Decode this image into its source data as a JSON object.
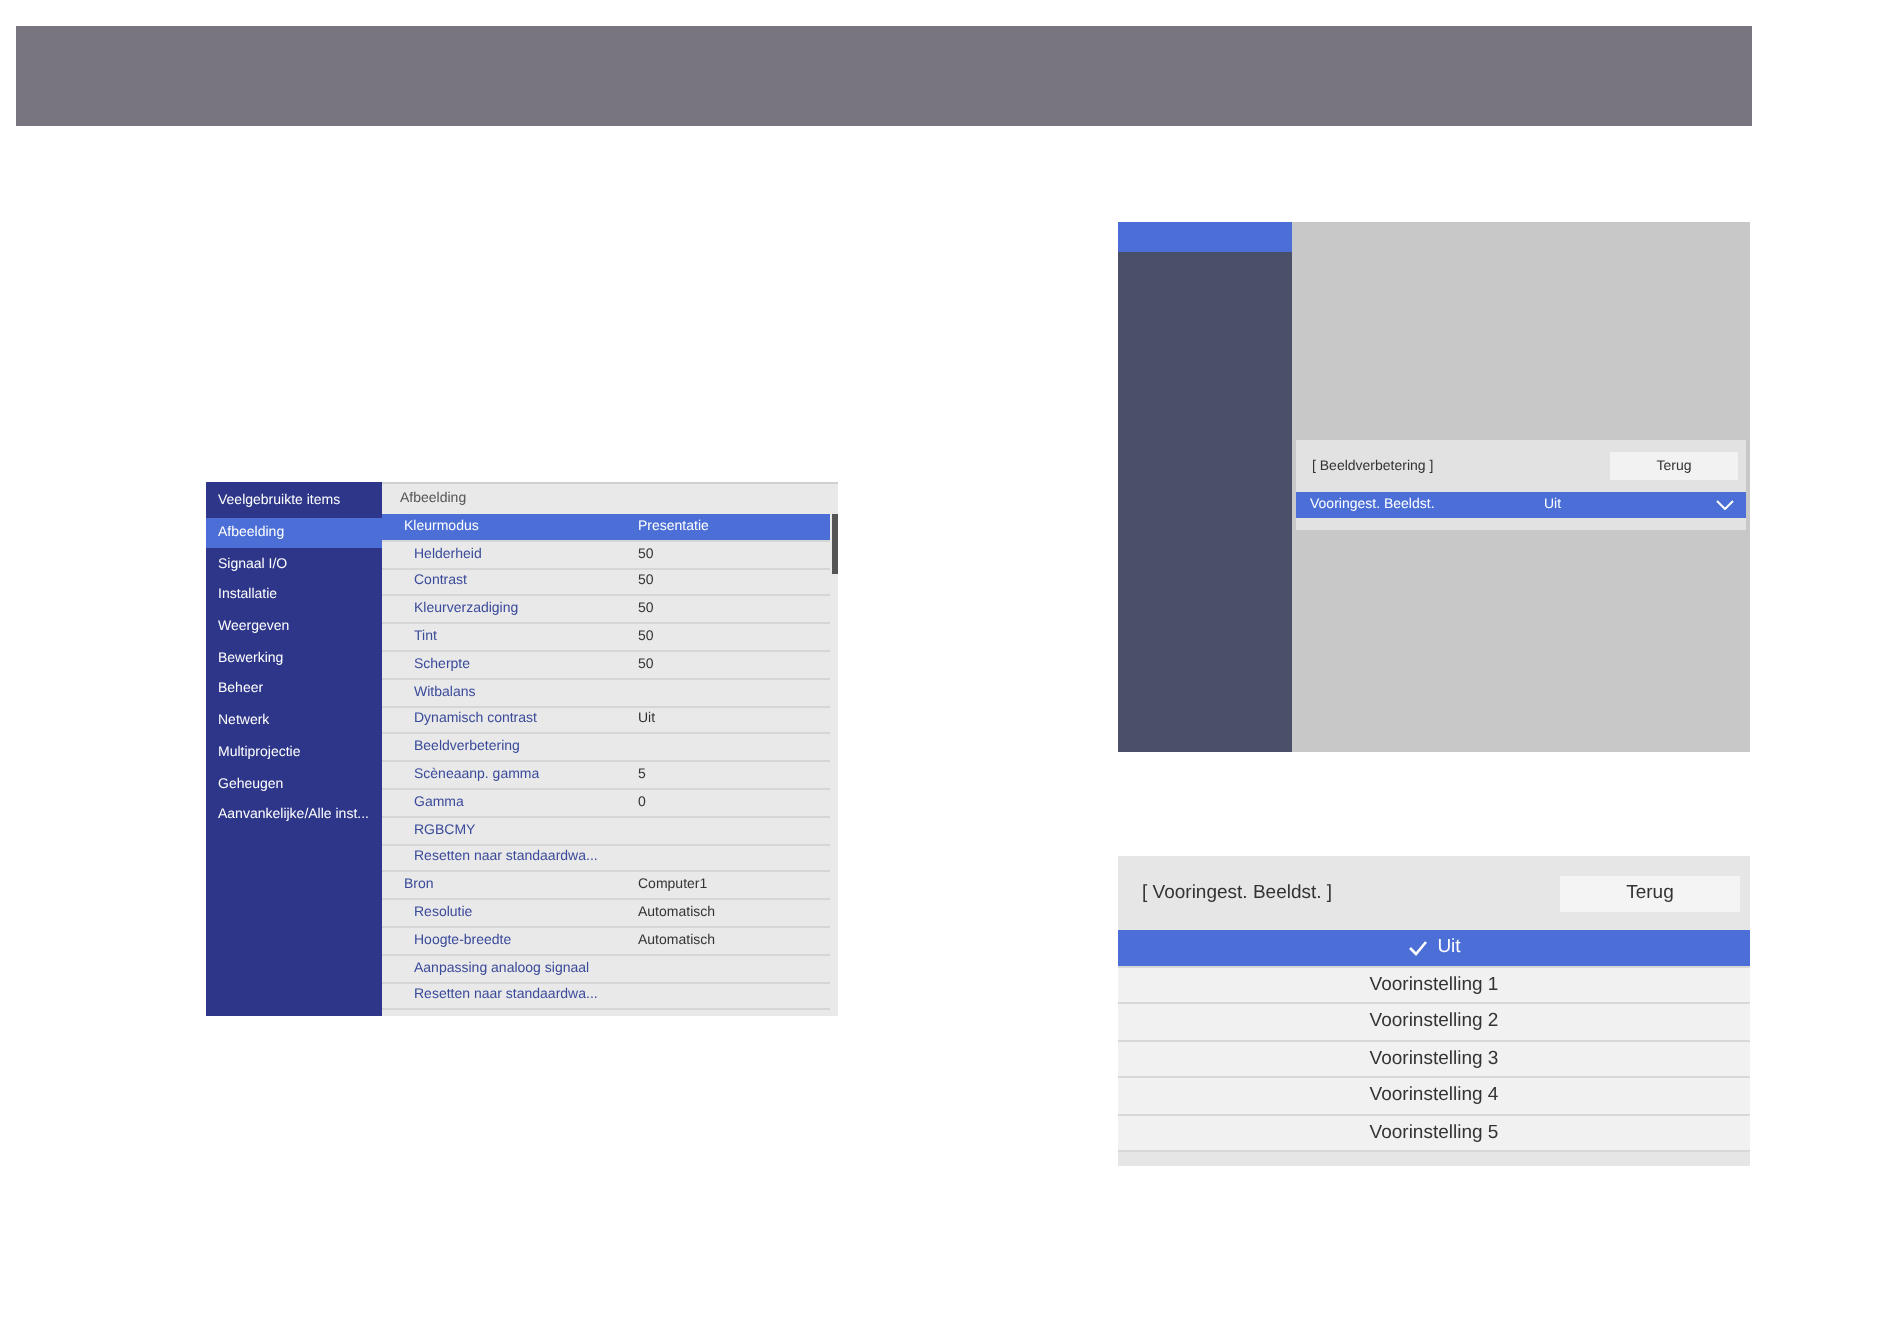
{
  "menu_screen": {
    "sidebar": [
      {
        "label": "Veelgebruikte items",
        "selected": false
      },
      {
        "label": "Afbeelding",
        "selected": true
      },
      {
        "label": "Signaal I/O",
        "selected": false
      },
      {
        "label": "Installatie",
        "selected": false
      },
      {
        "label": "Weergeven",
        "selected": false
      },
      {
        "label": "Bewerking",
        "selected": false
      },
      {
        "label": "Beheer",
        "selected": false
      },
      {
        "label": "Netwerk",
        "selected": false
      },
      {
        "label": "Multiprojectie",
        "selected": false
      },
      {
        "label": "Geheugen",
        "selected": false
      },
      {
        "label": "Aanvankelijke/Alle inst...",
        "selected": false
      }
    ],
    "panel_title": "Afbeelding",
    "groups": [
      {
        "label": "Kleurmodus",
        "value": "Presentatie",
        "selected": true,
        "children": [
          {
            "label": "Helderheid",
            "value": "50",
            "selected": false
          },
          {
            "label": "Contrast",
            "value": "50",
            "selected": false
          },
          {
            "label": "Kleurverzadiging",
            "value": "50",
            "selected": false
          },
          {
            "label": "Tint",
            "value": "50",
            "selected": false
          },
          {
            "label": "Scherpte",
            "value": "50",
            "selected": false
          },
          {
            "label": "Witbalans",
            "selected": false
          },
          {
            "label": "Dynamisch contrast",
            "value": "Uit",
            "selected": false
          },
          {
            "label": "Beeldverbetering",
            "selected": false
          },
          {
            "label": "Scèneaanp. gamma",
            "value": "5",
            "selected": false
          },
          {
            "label": "Gamma",
            "value": "0",
            "selected": false
          },
          {
            "label": "RGBCMY",
            "selected": false
          },
          {
            "label": "Resetten naar standaardwa...",
            "selected": false
          }
        ]
      },
      {
        "label": "Bron",
        "value": "Computer1",
        "selected": false,
        "children": [
          {
            "label": "Resolutie",
            "value": "Automatisch",
            "selected": false
          },
          {
            "label": "Hoogte-breedte",
            "value": "Automatisch",
            "selected": false
          },
          {
            "label": "Aanpassing analoog signaal",
            "selected": false
          },
          {
            "label": "Resetten naar standaardwa...",
            "selected": false
          }
        ]
      }
    ]
  },
  "enhancement_screen": {
    "title": "[ Beeldverbetering ]",
    "back_button": "Terug",
    "rows": [
      {
        "label": "Vooringest. Beeldst.",
        "value": "Uit",
        "selected": true
      }
    ]
  },
  "preset_screen": {
    "title": "[ Vooringest. Beeldst. ]",
    "back_button": "Terug",
    "options": [
      {
        "label": "Uit",
        "selected": true
      },
      {
        "label": "Voorinstelling 1",
        "selected": false
      },
      {
        "label": "Voorinstelling 2",
        "selected": false
      },
      {
        "label": "Voorinstelling 3",
        "selected": false
      },
      {
        "label": "Voorinstelling 4",
        "selected": false
      },
      {
        "label": "Voorinstelling 5",
        "selected": false
      }
    ]
  }
}
